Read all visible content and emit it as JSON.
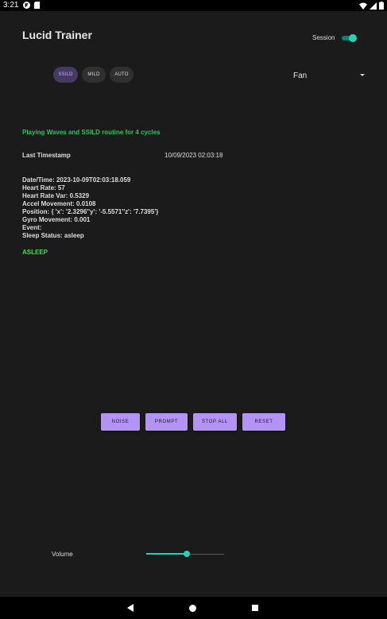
{
  "status_bar": {
    "time": "3:21"
  },
  "header": {
    "title": "Lucid Trainer",
    "session_label": "Session",
    "session_on": true
  },
  "modes": {
    "chips": [
      "SSILD",
      "MILD",
      "AUTO"
    ],
    "selected": "SSILD"
  },
  "sound_spinner": {
    "value": "Fan"
  },
  "routine_status": "Playing Waves and SSILD routine for 4 cycles",
  "timestamp": {
    "label": "Last Timestamp",
    "value": "10/09/2023 02:03:18"
  },
  "details": [
    "Date/Time: 2023-10-09T02:03:18.059",
    "Heart Rate: 57",
    "Heart Rate Var: 0.5329",
    "Accel Movement: 0.0108",
    "Position: { 'x': '2.3296''y': '-5.5571''z': '7.7395'}",
    "Gyro Movement: 0.001",
    "Event:",
    "Sleep Status: asleep"
  ],
  "sleep_state": "ASLEEP",
  "buttons": {
    "noise": "NOISE",
    "prompt": "PROMPT",
    "stop_all": "STOP ALL",
    "reset": "RESET"
  },
  "volume": {
    "label": "Volume",
    "level": 0.52
  },
  "colors": {
    "accent": "#2ad0b8",
    "button": "#b394f4",
    "status_green": "#1fcb5e",
    "asleep_green": "#39e04a"
  },
  "icons": [
    "flipboard-icon",
    "sd-card-icon",
    "wifi-icon",
    "signal-icon",
    "battery-icon",
    "back-icon",
    "home-icon",
    "recents-icon"
  ]
}
